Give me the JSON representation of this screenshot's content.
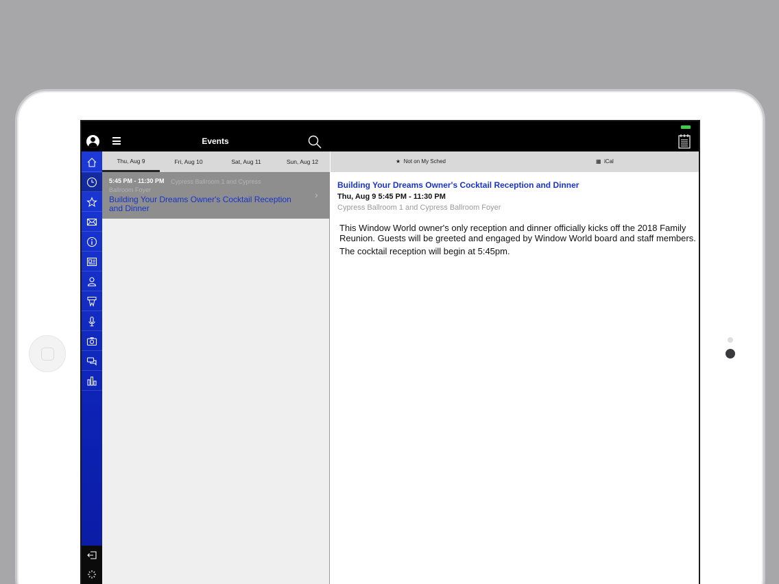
{
  "header": {
    "title": "Events"
  },
  "date_tabs": [
    {
      "label": "Thu, Aug 9",
      "active": true
    },
    {
      "label": "Fri, Aug 10",
      "active": false
    },
    {
      "label": "Sat, Aug 11",
      "active": false
    },
    {
      "label": "Sun, Aug 12",
      "active": false
    }
  ],
  "event_list": [
    {
      "time": "5:45 PM - 11:30 PM",
      "location": "Cypress Ballroom 1 and Cypress Ballroom Foyer",
      "title": "Building Your Dreams Owner's Cocktail Reception and Dinner"
    }
  ],
  "detail": {
    "toolbar": {
      "sched_label": "Not on My Sched",
      "ical_label": "iCal"
    },
    "title": "Building Your Dreams Owner's Cocktail Reception and Dinner",
    "datetime": "Thu, Aug 9 5:45 PM - 11:30 PM",
    "location": "Cypress Ballroom 1 and Cypress Ballroom Foyer",
    "description": "This Window World owner's only reception and dinner officially kicks off the 2018 Family Reunion. Guests will be greeted and engaged by Window World board and staff members.",
    "description2": "The cocktail reception will begin at 5:45pm."
  },
  "nav_icons": [
    "home-icon",
    "clock-icon",
    "star-icon",
    "mail-icon",
    "info-icon",
    "newspaper-icon",
    "people-icon",
    "ribbon-icon",
    "microphone-icon",
    "camera-icon",
    "chat-icon",
    "chart-icon"
  ],
  "colors": {
    "nav_blue": "#1c3ad8",
    "title_blue": "#1934c8",
    "battery_green": "#3ecf4a"
  }
}
